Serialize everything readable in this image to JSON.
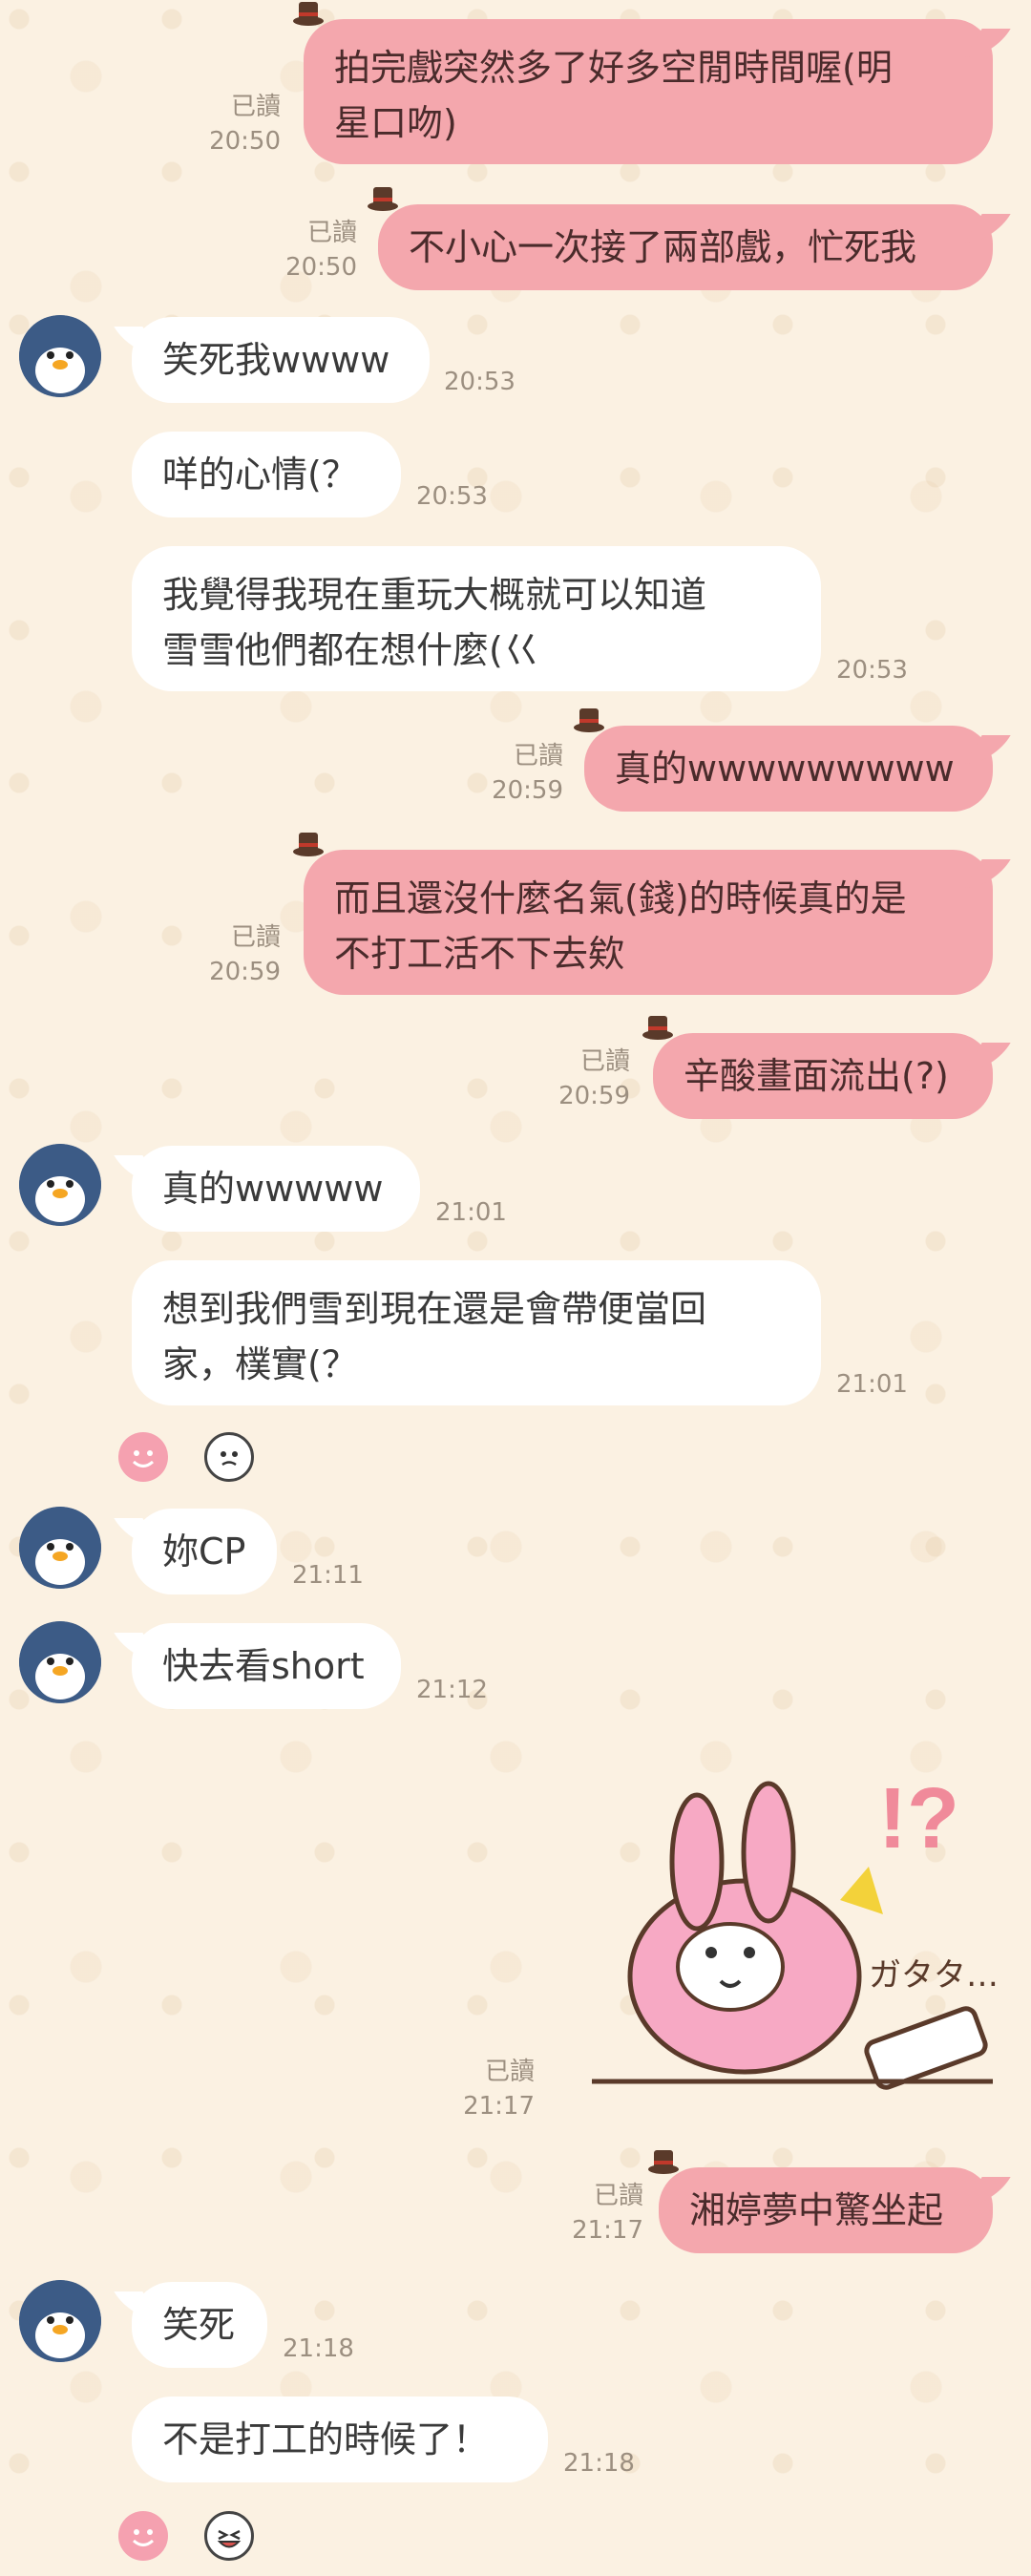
{
  "colors": {
    "background": "#fbf1e2",
    "outgoing": "#f4a7ad",
    "incoming": "#ffffff",
    "meta": "#9c8f80",
    "avatar": "#3c5b86"
  },
  "read_label": "已讀",
  "messages": [
    {
      "dir": "out",
      "lines": [
        "拍完戲突然多了好多空閒時間喔(明",
        "星口吻)"
      ],
      "time": "20:50",
      "read": true
    },
    {
      "dir": "out",
      "lines": [
        "不小心一次接了兩部戲，忙死我"
      ],
      "time": "20:50",
      "read": true
    },
    {
      "dir": "in",
      "lines": [
        "笑死我wwww"
      ],
      "time": "20:53",
      "avatar": true
    },
    {
      "dir": "in",
      "lines": [
        "咩的心情(？"
      ],
      "time": "20:53"
    },
    {
      "dir": "in",
      "lines": [
        "我覺得我現在重玩大概就可以知道",
        "雪雪他們都在想什麼(巜"
      ],
      "time": "20:53"
    },
    {
      "dir": "out",
      "lines": [
        "真的wwwwwwwww"
      ],
      "time": "20:59",
      "read": true
    },
    {
      "dir": "out",
      "lines": [
        "而且還沒什麼名氣(錢)的時候真的是",
        "不打工活不下去欸"
      ],
      "time": "20:59",
      "read": true
    },
    {
      "dir": "out",
      "lines": [
        "辛酸畫面流出(?)"
      ],
      "time": "20:59",
      "read": true
    },
    {
      "dir": "in",
      "lines": [
        "真的wwwww"
      ],
      "time": "21:01",
      "avatar": true
    },
    {
      "dir": "in",
      "lines": [
        "想到我們雪到現在還是會帶便當回",
        "家，樸實(？"
      ],
      "time": "21:01"
    },
    {
      "dir": "in",
      "lines": [
        "妳CP"
      ],
      "time": "21:11",
      "avatar": true
    },
    {
      "dir": "in",
      "lines": [
        "快去看short"
      ],
      "time": "21:12",
      "avatar": true
    },
    {
      "dir": "out",
      "lines": [
        "湘婷夢中驚坐起"
      ],
      "time": "21:17",
      "read": true
    },
    {
      "dir": "in",
      "lines": [
        "笑死"
      ],
      "time": "21:18",
      "avatar": true
    },
    {
      "dir": "in",
      "lines": [
        "不是打工的時候了！"
      ],
      "time": "21:18"
    }
  ],
  "sticker": {
    "time": "21:17",
    "read": true,
    "text": "ガタタ…",
    "icon": "rabbit-sticker",
    "exclaim": "!?"
  },
  "reactions": [
    {
      "icons": [
        "smile-reaction-icon",
        "face-reaction-icon"
      ]
    },
    {
      "icons": [
        "smile-reaction-icon",
        "laugh-reaction-icon"
      ]
    }
  ]
}
